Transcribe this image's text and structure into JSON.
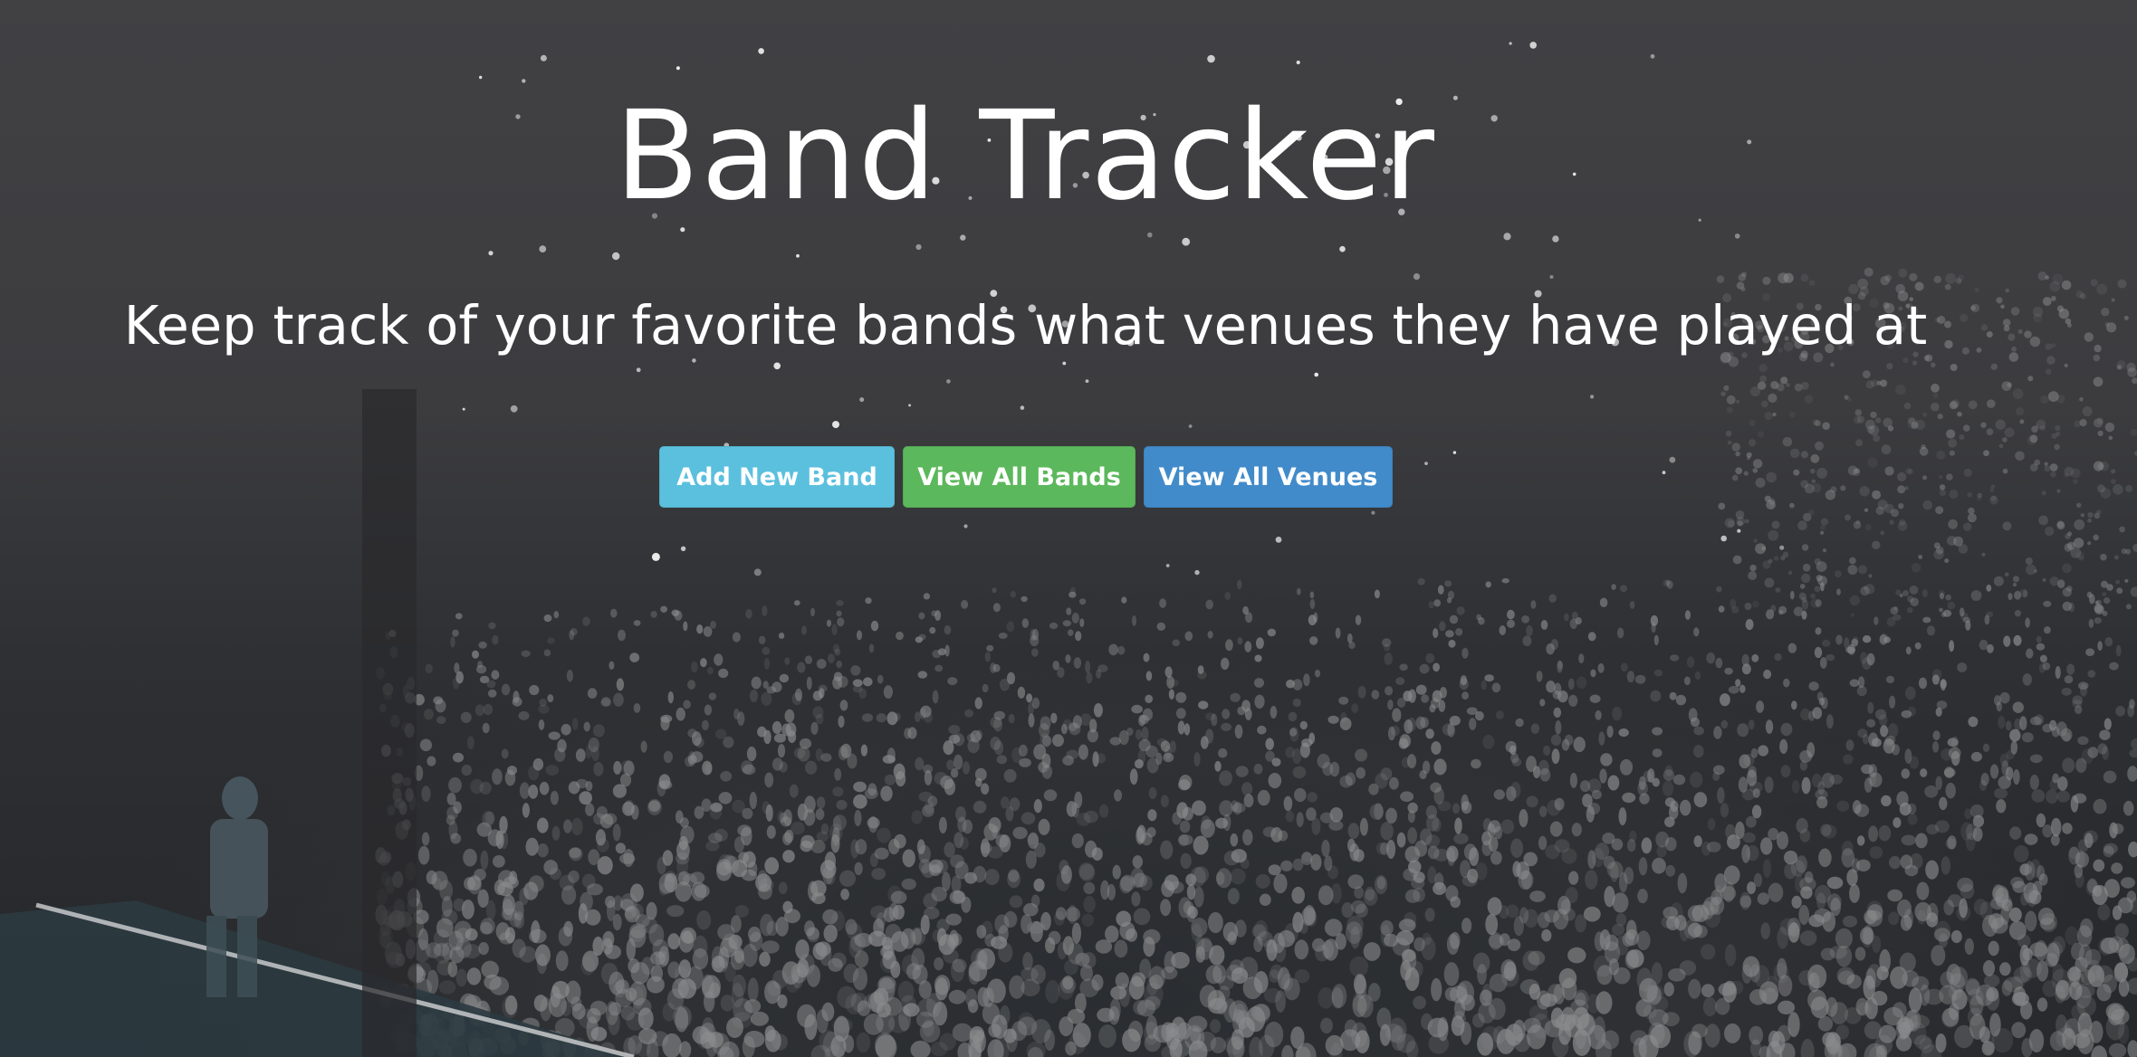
{
  "hero": {
    "title": "Band Tracker",
    "subtitle": "Keep track of your favorite bands what venues they have played at"
  },
  "actions": {
    "add_new_band": "Add New Band",
    "view_all_bands": "View All Bands",
    "view_all_venues": "View All Venues"
  },
  "colors": {
    "overlay": "#3d3d40",
    "btn_info": "#5bc0de",
    "btn_success": "#5cb85c",
    "btn_primary": "#428bca"
  }
}
